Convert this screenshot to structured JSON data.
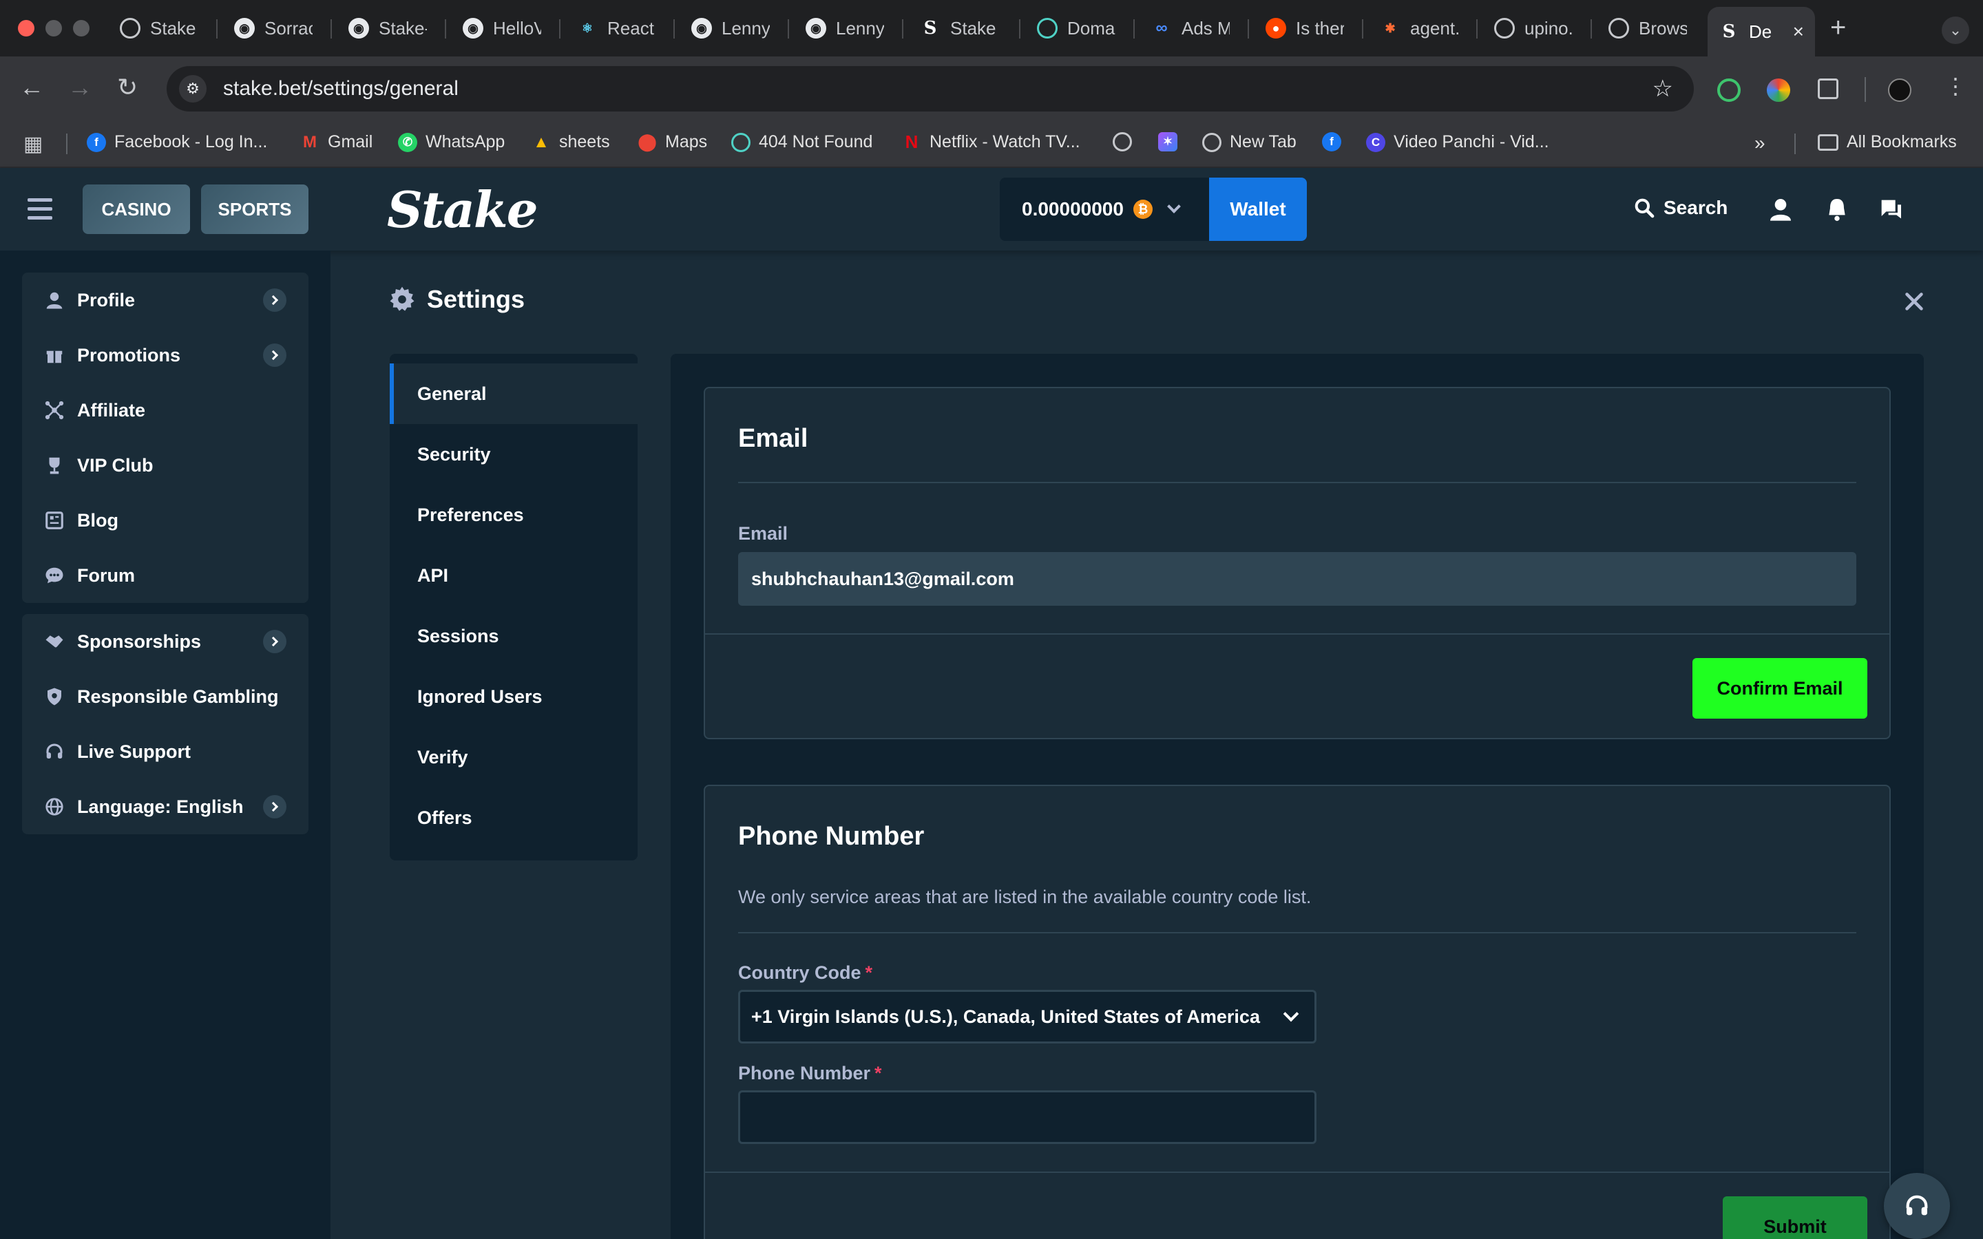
{
  "browser": {
    "tabs": [
      {
        "title": "Stake"
      },
      {
        "title": "Sorrac"
      },
      {
        "title": "Stake-"
      },
      {
        "title": "HelloV"
      },
      {
        "title": "React"
      },
      {
        "title": "Lenny"
      },
      {
        "title": "Lenny"
      },
      {
        "title": "Stake"
      },
      {
        "title": "Domai"
      },
      {
        "title": "Ads M"
      },
      {
        "title": "Is ther"
      },
      {
        "title": "agent."
      },
      {
        "title": "upino."
      },
      {
        "title": "Brows"
      },
      {
        "title": "De"
      }
    ],
    "new_tab": "+",
    "url": "stake.bet/settings/general",
    "bookmarks": [
      {
        "label": "Facebook - Log In..."
      },
      {
        "label": "Gmail"
      },
      {
        "label": "WhatsApp"
      },
      {
        "label": "sheets"
      },
      {
        "label": "Maps"
      },
      {
        "label": "404 Not Found"
      },
      {
        "label": "Netflix - Watch TV..."
      },
      {
        "label": "New Tab"
      },
      {
        "label": "Video Panchi - Vid..."
      }
    ],
    "more_bookmarks": "»",
    "all_bookmarks": "All Bookmarks"
  },
  "header": {
    "casino": "CASINO",
    "sports": "SPORTS",
    "logo": "Stake",
    "balance": "0.00000000",
    "currency_symbol": "₿",
    "wallet": "Wallet",
    "search": "Search"
  },
  "sidebar": {
    "group1": [
      {
        "label": "Profile",
        "icon": "user-icon",
        "arrow": true
      },
      {
        "label": "Promotions",
        "icon": "gift-icon",
        "arrow": true
      },
      {
        "label": "Affiliate",
        "icon": "affiliate-icon",
        "arrow": false
      },
      {
        "label": "VIP Club",
        "icon": "trophy-icon",
        "arrow": false
      },
      {
        "label": "Blog",
        "icon": "blog-icon",
        "arrow": false
      },
      {
        "label": "Forum",
        "icon": "forum-icon",
        "arrow": false
      }
    ],
    "group2": [
      {
        "label": "Sponsorships",
        "icon": "handshake-icon",
        "arrow": true
      },
      {
        "label": "Responsible Gambling",
        "icon": "shield-icon",
        "arrow": false
      },
      {
        "label": "Live Support",
        "icon": "headset-icon",
        "arrow": false
      },
      {
        "label": "Language: English",
        "icon": "globe-icon",
        "arrow": true
      }
    ]
  },
  "settings": {
    "title": "Settings",
    "nav": [
      {
        "label": "General",
        "active": true
      },
      {
        "label": "Security"
      },
      {
        "label": "Preferences"
      },
      {
        "label": "API"
      },
      {
        "label": "Sessions"
      },
      {
        "label": "Ignored Users"
      },
      {
        "label": "Verify"
      },
      {
        "label": "Offers"
      }
    ],
    "email_card": {
      "heading": "Email",
      "field_label": "Email",
      "value": "shubhchauhan13@gmail.com",
      "button": "Confirm Email"
    },
    "phone_card": {
      "heading": "Phone Number",
      "description": "We only service areas that are listed in the available country code list.",
      "country_label": "Country Code",
      "country_value": "+1 Virgin Islands (U.S.), Canada, United States of America",
      "phone_label": "Phone Number",
      "required_mark": "*",
      "button": "Submit"
    }
  },
  "colors": {
    "accent_blue": "#1475e1",
    "green_button": "#1fff20",
    "background": "#0f212e",
    "surface": "#1a2c38"
  }
}
